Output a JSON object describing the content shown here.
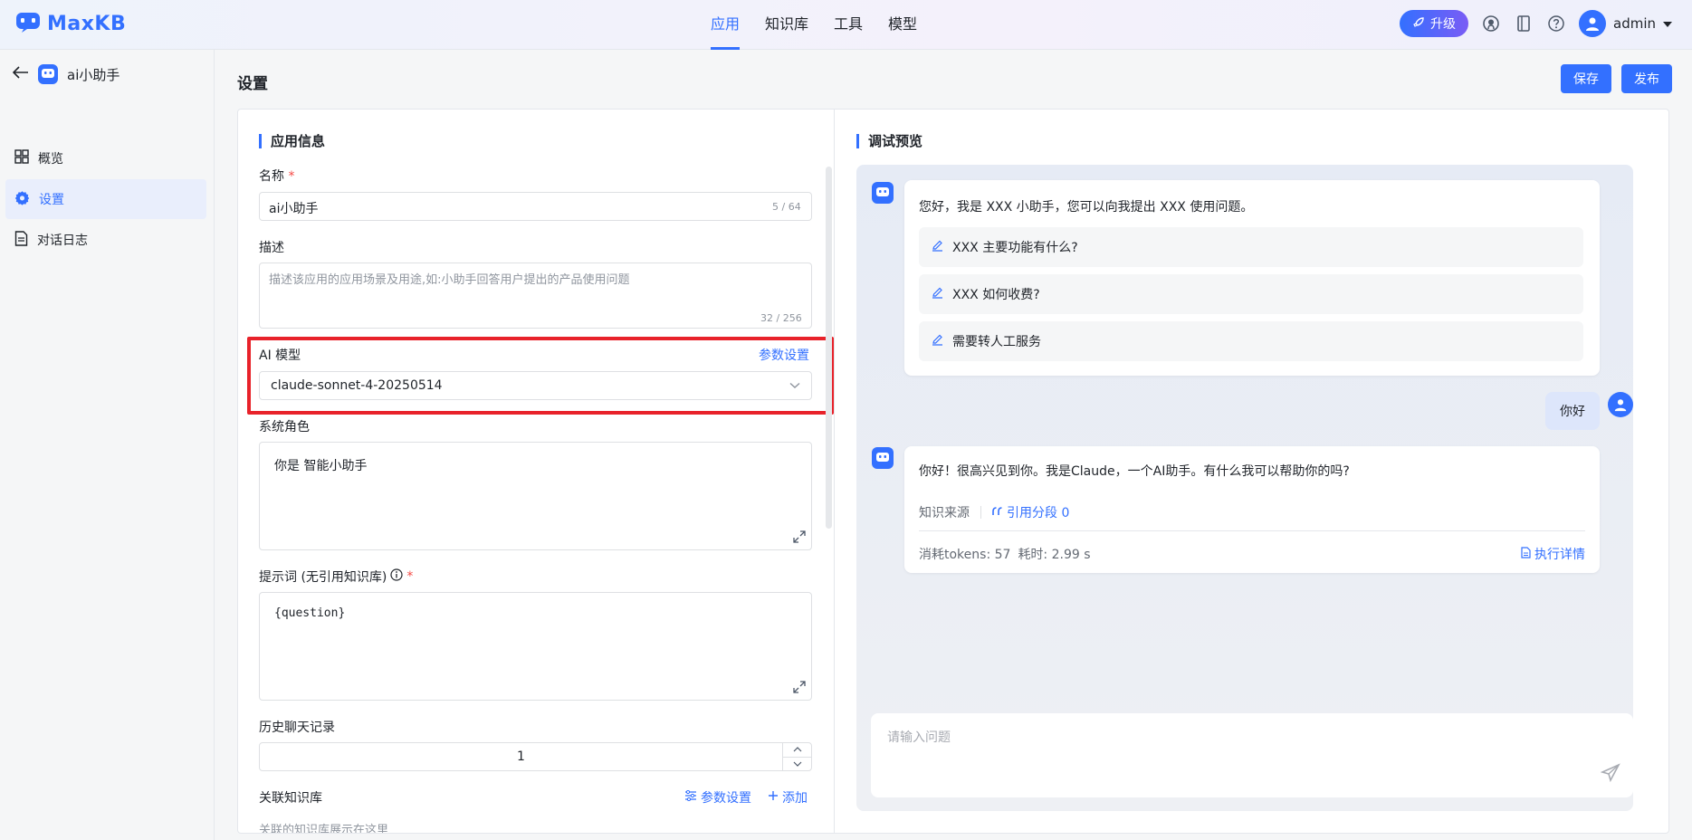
{
  "brand": {
    "name": "MaxKB"
  },
  "nav": [
    "应用",
    "知识库",
    "工具",
    "模型"
  ],
  "nav_active": 0,
  "header": {
    "upgrade": "升级",
    "user": "admin"
  },
  "sidebar": {
    "app_name": "ai小助手",
    "items": [
      {
        "label": "概览",
        "icon": "grid-icon"
      },
      {
        "label": "设置",
        "icon": "gear-icon",
        "active": true
      },
      {
        "label": "对话日志",
        "icon": "document-icon"
      }
    ]
  },
  "page": {
    "title": "设置",
    "save": "保存",
    "publish": "发布"
  },
  "form": {
    "section": "应用信息",
    "name_label": "名称",
    "name_value": "ai小助手",
    "name_counter": "5 / 64",
    "desc_label": "描述",
    "desc_placeholder": "描述该应用的应用场景及用途,如:小助手回答用户提出的产品使用问题",
    "desc_counter": "32 / 256",
    "model_label": "AI 模型",
    "model_params": "参数设置",
    "model_value": "claude-sonnet-4-20250514",
    "role_label": "系统角色",
    "role_value": "你是 智能小助手",
    "prompt_label": "提示词 (无引用知识库)",
    "prompt_value": "{question}",
    "history_label": "历史聊天记录",
    "history_value": "1",
    "kb_label": "关联知识库",
    "kb_params": "参数设置",
    "kb_add": "添加",
    "kb_hint": "关联的知识库展示在这里"
  },
  "preview": {
    "title": "调试预览",
    "greeting": "您好，我是 XXX 小助手，您可以向我提出 XXX 使用问题。",
    "suggestions": [
      "XXX 主要功能有什么?",
      "XXX 如何收费?",
      "需要转人工服务"
    ],
    "user_message": "你好",
    "answer": "你好！很高兴见到你。我是Claude，一个AI助手。有什么我可以帮助你的吗?",
    "source_label": "知识来源",
    "cite": "引用分段 0",
    "tokens": "消耗tokens: 57",
    "time": "耗时: 2.99 s",
    "details": "执行详情",
    "input_placeholder": "请输入问题"
  },
  "colors": {
    "accent": "#3370ff",
    "highlight": "#e8222a"
  }
}
